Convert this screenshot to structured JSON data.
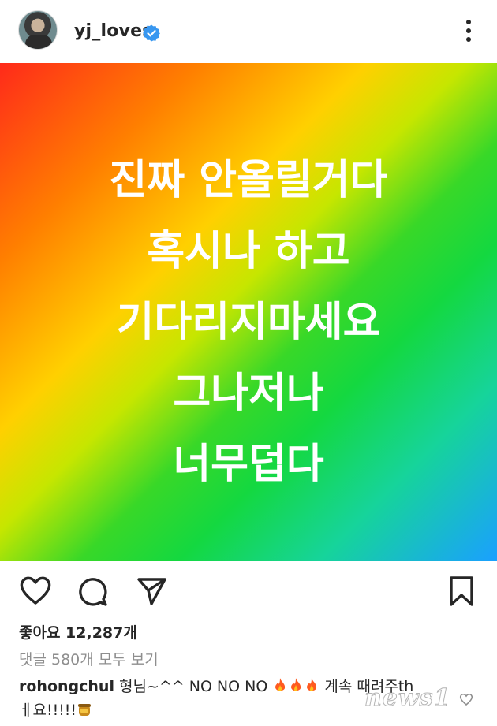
{
  "header": {
    "username": "yj_loves",
    "verified": true,
    "avatar_icon": "profile-photo",
    "more_icon": "more-vertical-icon"
  },
  "post": {
    "lines": [
      "진짜 안올릴거다",
      "혹시나 하고",
      "기다리지마세요",
      "그나저나",
      "너무덥다"
    ],
    "background_colors": [
      "#ff2a1a",
      "#ff7f00",
      "#ffd000",
      "#38d828",
      "#1aa0ff"
    ],
    "text_color": "#ffffff"
  },
  "actions": {
    "like_icon": "heart-icon",
    "comment_icon": "comment-icon",
    "share_icon": "send-icon",
    "save_icon": "bookmark-icon"
  },
  "likes_text": "좋아요 12,287개",
  "view_comments_text": "댓글 580개 모두 보기",
  "comment": {
    "username": "rohongchul",
    "text_part1": "형님~^^ NO NO NO",
    "emojis": [
      "fire",
      "fire",
      "fire",
      "honey-pot"
    ],
    "text_part2": "계속 때려주th",
    "text_part3": "ㅔ요!!!!!"
  },
  "watermark": "news1"
}
